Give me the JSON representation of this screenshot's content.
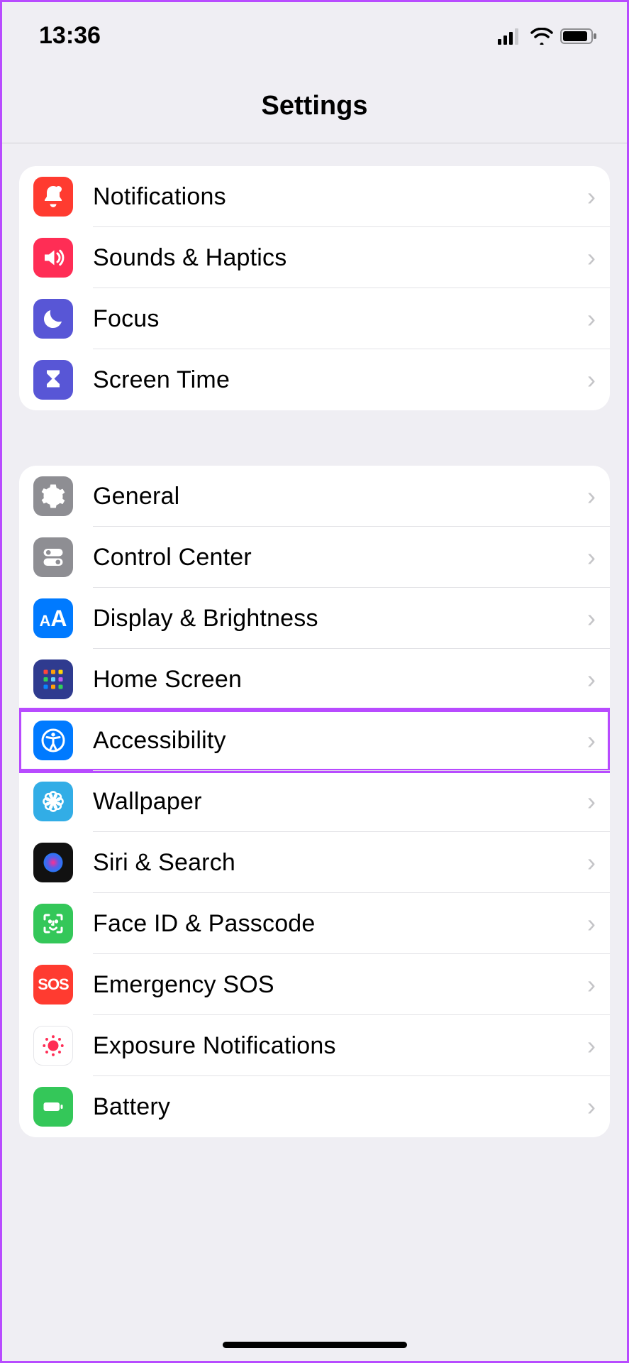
{
  "status": {
    "time": "13:36"
  },
  "header": {
    "title": "Settings"
  },
  "groups": [
    {
      "items": [
        {
          "icon": "bell-icon",
          "label": "Notifications"
        },
        {
          "icon": "speaker-icon",
          "label": "Sounds & Haptics"
        },
        {
          "icon": "moon-icon",
          "label": "Focus"
        },
        {
          "icon": "hourglass-icon",
          "label": "Screen Time"
        }
      ]
    },
    {
      "items": [
        {
          "icon": "gear-icon",
          "label": "General"
        },
        {
          "icon": "toggles-icon",
          "label": "Control Center"
        },
        {
          "icon": "text-size-icon",
          "label": "Display & Brightness"
        },
        {
          "icon": "home-grid-icon",
          "label": "Home Screen"
        },
        {
          "icon": "accessibility-icon",
          "label": "Accessibility",
          "highlighted": true
        },
        {
          "icon": "flower-icon",
          "label": "Wallpaper"
        },
        {
          "icon": "siri-icon",
          "label": "Siri & Search"
        },
        {
          "icon": "faceid-icon",
          "label": "Face ID & Passcode"
        },
        {
          "icon": "sos-icon",
          "label": "Emergency SOS"
        },
        {
          "icon": "exposure-icon",
          "label": "Exposure Notifications"
        },
        {
          "icon": "battery-icon",
          "label": "Battery"
        }
      ]
    }
  ]
}
